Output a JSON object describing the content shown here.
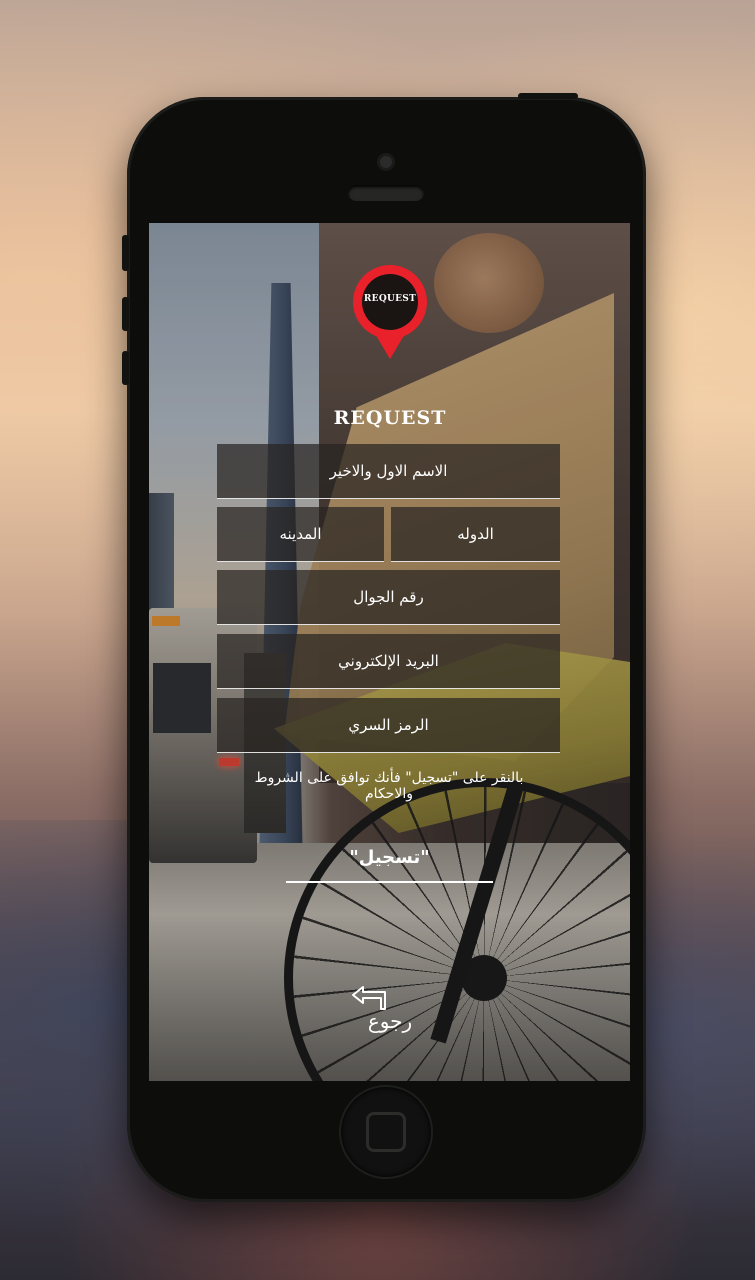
{
  "app": {
    "logo_pin_text": "REQUEST",
    "logo_word": "REQUEST"
  },
  "form": {
    "full_name_placeholder": "الاسم الاول والاخير",
    "country_placeholder": "الدوله",
    "city_placeholder": "المدينه",
    "phone_placeholder": "رقم الجوال",
    "email_placeholder": "البريد الإلكتروني",
    "password_placeholder": "الرمز السري"
  },
  "terms_text": "بالنقر على \"تسجيل\" فأنك توافق على الشروط والاحكام",
  "register_label": "\"تسجيل\"",
  "back_label": "رجوع",
  "colors": {
    "accent": "#e8212b",
    "phone_body": "#0d0e0c",
    "field_bg": "rgba(40,36,33,0.72)"
  },
  "icons": {
    "back": "back-arrow-icon",
    "logo": "location-pin-icon"
  }
}
